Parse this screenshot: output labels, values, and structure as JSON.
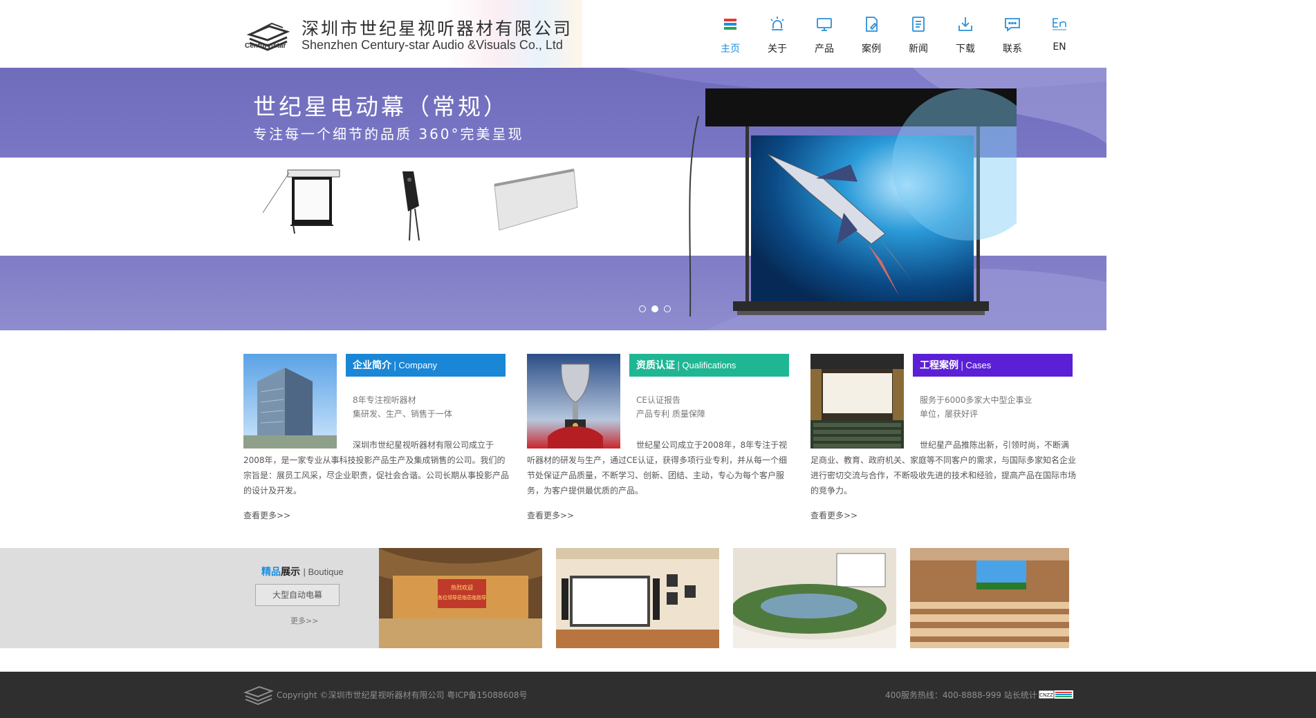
{
  "header": {
    "logo": {
      "brand": "Century-star",
      "cn_name": "深圳市世纪星视听器材有限公司",
      "en_name": "Shenzhen Century-star Audio &Visuals Co., Ltd"
    },
    "nav": [
      {
        "label": "主页",
        "icon": "home-bars-icon",
        "active": true
      },
      {
        "label": "关于",
        "icon": "alarm-light-icon",
        "active": false
      },
      {
        "label": "产品",
        "icon": "monitor-icon",
        "active": false
      },
      {
        "label": "案例",
        "icon": "document-edit-icon",
        "active": false
      },
      {
        "label": "新闻",
        "icon": "news-list-icon",
        "active": false
      },
      {
        "label": "下载",
        "icon": "download-icon",
        "active": false
      },
      {
        "label": "联系",
        "icon": "chat-bubble-icon",
        "active": false
      },
      {
        "label": "EN",
        "icon": "en-language-icon",
        "active": false
      }
    ],
    "nav_active_color": "#1a8fe0"
  },
  "banner": {
    "title": "世纪星电动幕（常规）",
    "subtitle": "专注每一个细节的品质 360°完美呈现",
    "dots": [
      false,
      true,
      false
    ]
  },
  "columns": [
    {
      "title_cn": "企业简介",
      "title_en": "Company",
      "color": "#1a86d6",
      "tag_lines": [
        "8年专注视听器材",
        "集研发、生产、销售于一体"
      ],
      "desc": "深圳市世纪星视听器材有限公司成立于2008年，是一家专业从事科技投影产品生产及集成销售的公司。我们的宗旨是：展员工风采，尽企业职责，促社会合谐。公司长期从事投影产品的设计及开发。",
      "more": "查看更多>>"
    },
    {
      "title_cn": "资质认证",
      "title_en": "Qualifications",
      "color": "#1fb694",
      "tag_lines": [
        "CE认证报告",
        "产品专利 质量保障"
      ],
      "desc": "世纪星公司成立于2008年，8年专注于视听器材的研发与生产，通过CE认证，获得多项行业专利，并从每一个细节处保证产品质量，不断学习、创新、团结、主动，专心为每个客户服务，为客户提供最优质的产品。",
      "more": "查看更多>>"
    },
    {
      "title_cn": "工程案例",
      "title_en": "Cases",
      "color": "#5b1fd6",
      "tag_lines": [
        "服务于6000多家大中型企事业",
        "单位，屡获好评"
      ],
      "desc": "世纪星产品推陈出新，引领时尚，不断满足商业、教育、政府机关、家庭等不同客户的需求，与国际多家知名企业进行密切交流与合作，不断吸收先进的技术和经验，提高产品在国际市场的竞争力。",
      "more": "查看更多>>"
    }
  ],
  "boutique": {
    "title_c1": "精品",
    "title_c2": "展示",
    "title_en": "Boutique",
    "button": "大型自动电幕",
    "more": "更多>>",
    "hall_banner_line1": "热烈欢迎",
    "hall_banner_line2": "各位领导莅临莅临指导"
  },
  "footer": {
    "copyright": "Copyright ©深圳市世纪星视听器材有限公司 粤ICP备15088608号",
    "hotline": "400服务热线：400-8888-999 站长统计：",
    "badge": "CNZZ"
  }
}
